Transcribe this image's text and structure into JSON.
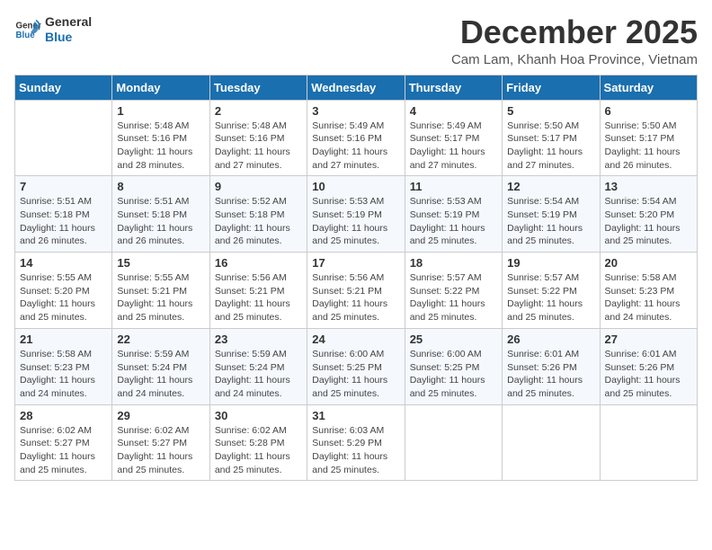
{
  "logo": {
    "line1": "General",
    "line2": "Blue"
  },
  "title": "December 2025",
  "subtitle": "Cam Lam, Khanh Hoa Province, Vietnam",
  "weekdays": [
    "Sunday",
    "Monday",
    "Tuesday",
    "Wednesday",
    "Thursday",
    "Friday",
    "Saturday"
  ],
  "weeks": [
    [
      {
        "day": "",
        "info": ""
      },
      {
        "day": "1",
        "info": "Sunrise: 5:48 AM\nSunset: 5:16 PM\nDaylight: 11 hours\nand 28 minutes."
      },
      {
        "day": "2",
        "info": "Sunrise: 5:48 AM\nSunset: 5:16 PM\nDaylight: 11 hours\nand 27 minutes."
      },
      {
        "day": "3",
        "info": "Sunrise: 5:49 AM\nSunset: 5:16 PM\nDaylight: 11 hours\nand 27 minutes."
      },
      {
        "day": "4",
        "info": "Sunrise: 5:49 AM\nSunset: 5:17 PM\nDaylight: 11 hours\nand 27 minutes."
      },
      {
        "day": "5",
        "info": "Sunrise: 5:50 AM\nSunset: 5:17 PM\nDaylight: 11 hours\nand 27 minutes."
      },
      {
        "day": "6",
        "info": "Sunrise: 5:50 AM\nSunset: 5:17 PM\nDaylight: 11 hours\nand 26 minutes."
      }
    ],
    [
      {
        "day": "7",
        "info": "Sunrise: 5:51 AM\nSunset: 5:18 PM\nDaylight: 11 hours\nand 26 minutes."
      },
      {
        "day": "8",
        "info": "Sunrise: 5:51 AM\nSunset: 5:18 PM\nDaylight: 11 hours\nand 26 minutes."
      },
      {
        "day": "9",
        "info": "Sunrise: 5:52 AM\nSunset: 5:18 PM\nDaylight: 11 hours\nand 26 minutes."
      },
      {
        "day": "10",
        "info": "Sunrise: 5:53 AM\nSunset: 5:19 PM\nDaylight: 11 hours\nand 25 minutes."
      },
      {
        "day": "11",
        "info": "Sunrise: 5:53 AM\nSunset: 5:19 PM\nDaylight: 11 hours\nand 25 minutes."
      },
      {
        "day": "12",
        "info": "Sunrise: 5:54 AM\nSunset: 5:19 PM\nDaylight: 11 hours\nand 25 minutes."
      },
      {
        "day": "13",
        "info": "Sunrise: 5:54 AM\nSunset: 5:20 PM\nDaylight: 11 hours\nand 25 minutes."
      }
    ],
    [
      {
        "day": "14",
        "info": "Sunrise: 5:55 AM\nSunset: 5:20 PM\nDaylight: 11 hours\nand 25 minutes."
      },
      {
        "day": "15",
        "info": "Sunrise: 5:55 AM\nSunset: 5:21 PM\nDaylight: 11 hours\nand 25 minutes."
      },
      {
        "day": "16",
        "info": "Sunrise: 5:56 AM\nSunset: 5:21 PM\nDaylight: 11 hours\nand 25 minutes."
      },
      {
        "day": "17",
        "info": "Sunrise: 5:56 AM\nSunset: 5:21 PM\nDaylight: 11 hours\nand 25 minutes."
      },
      {
        "day": "18",
        "info": "Sunrise: 5:57 AM\nSunset: 5:22 PM\nDaylight: 11 hours\nand 25 minutes."
      },
      {
        "day": "19",
        "info": "Sunrise: 5:57 AM\nSunset: 5:22 PM\nDaylight: 11 hours\nand 25 minutes."
      },
      {
        "day": "20",
        "info": "Sunrise: 5:58 AM\nSunset: 5:23 PM\nDaylight: 11 hours\nand 24 minutes."
      }
    ],
    [
      {
        "day": "21",
        "info": "Sunrise: 5:58 AM\nSunset: 5:23 PM\nDaylight: 11 hours\nand 24 minutes."
      },
      {
        "day": "22",
        "info": "Sunrise: 5:59 AM\nSunset: 5:24 PM\nDaylight: 11 hours\nand 24 minutes."
      },
      {
        "day": "23",
        "info": "Sunrise: 5:59 AM\nSunset: 5:24 PM\nDaylight: 11 hours\nand 24 minutes."
      },
      {
        "day": "24",
        "info": "Sunrise: 6:00 AM\nSunset: 5:25 PM\nDaylight: 11 hours\nand 25 minutes."
      },
      {
        "day": "25",
        "info": "Sunrise: 6:00 AM\nSunset: 5:25 PM\nDaylight: 11 hours\nand 25 minutes."
      },
      {
        "day": "26",
        "info": "Sunrise: 6:01 AM\nSunset: 5:26 PM\nDaylight: 11 hours\nand 25 minutes."
      },
      {
        "day": "27",
        "info": "Sunrise: 6:01 AM\nSunset: 5:26 PM\nDaylight: 11 hours\nand 25 minutes."
      }
    ],
    [
      {
        "day": "28",
        "info": "Sunrise: 6:02 AM\nSunset: 5:27 PM\nDaylight: 11 hours\nand 25 minutes."
      },
      {
        "day": "29",
        "info": "Sunrise: 6:02 AM\nSunset: 5:27 PM\nDaylight: 11 hours\nand 25 minutes."
      },
      {
        "day": "30",
        "info": "Sunrise: 6:02 AM\nSunset: 5:28 PM\nDaylight: 11 hours\nand 25 minutes."
      },
      {
        "day": "31",
        "info": "Sunrise: 6:03 AM\nSunset: 5:29 PM\nDaylight: 11 hours\nand 25 minutes."
      },
      {
        "day": "",
        "info": ""
      },
      {
        "day": "",
        "info": ""
      },
      {
        "day": "",
        "info": ""
      }
    ]
  ]
}
